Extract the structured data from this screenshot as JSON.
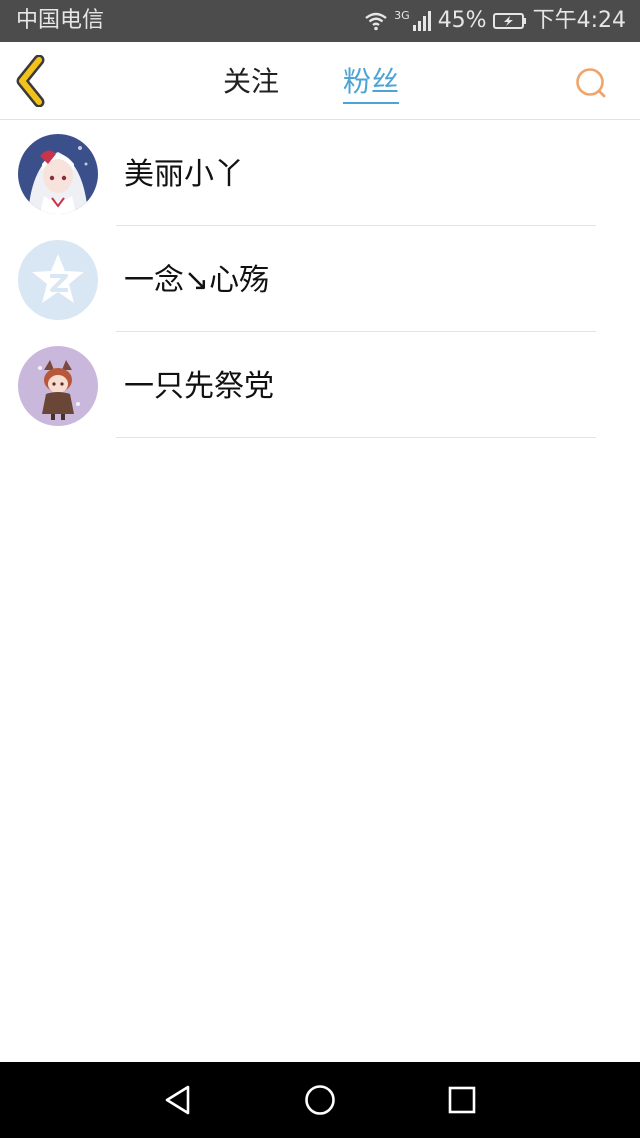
{
  "status_bar": {
    "carrier": "中国电信",
    "network_type": "3G",
    "battery_percent": "45%",
    "time": "下午4:24",
    "icons": [
      "wifi-icon",
      "signal-icon",
      "battery-charging-icon"
    ]
  },
  "header": {
    "back_icon": "chevron-left-icon",
    "tabs": [
      {
        "label": "关注",
        "active": false
      },
      {
        "label": "粉丝",
        "active": true
      }
    ],
    "search_icon": "search-icon",
    "colors": {
      "active_tab": "#4ba3d6",
      "back_icon": "#f2c21a",
      "search_icon": "#f0a46a"
    }
  },
  "fans": [
    {
      "name": "美丽小丫",
      "avatar": "anime-girl-avatar"
    },
    {
      "name": "一念↘心殇",
      "avatar": "qzone-default-avatar"
    },
    {
      "name": "一只先祭党",
      "avatar": "chibi-character-avatar"
    }
  ],
  "nav_bar": {
    "icons": [
      "nav-back-icon",
      "nav-home-icon",
      "nav-recent-icon"
    ]
  }
}
